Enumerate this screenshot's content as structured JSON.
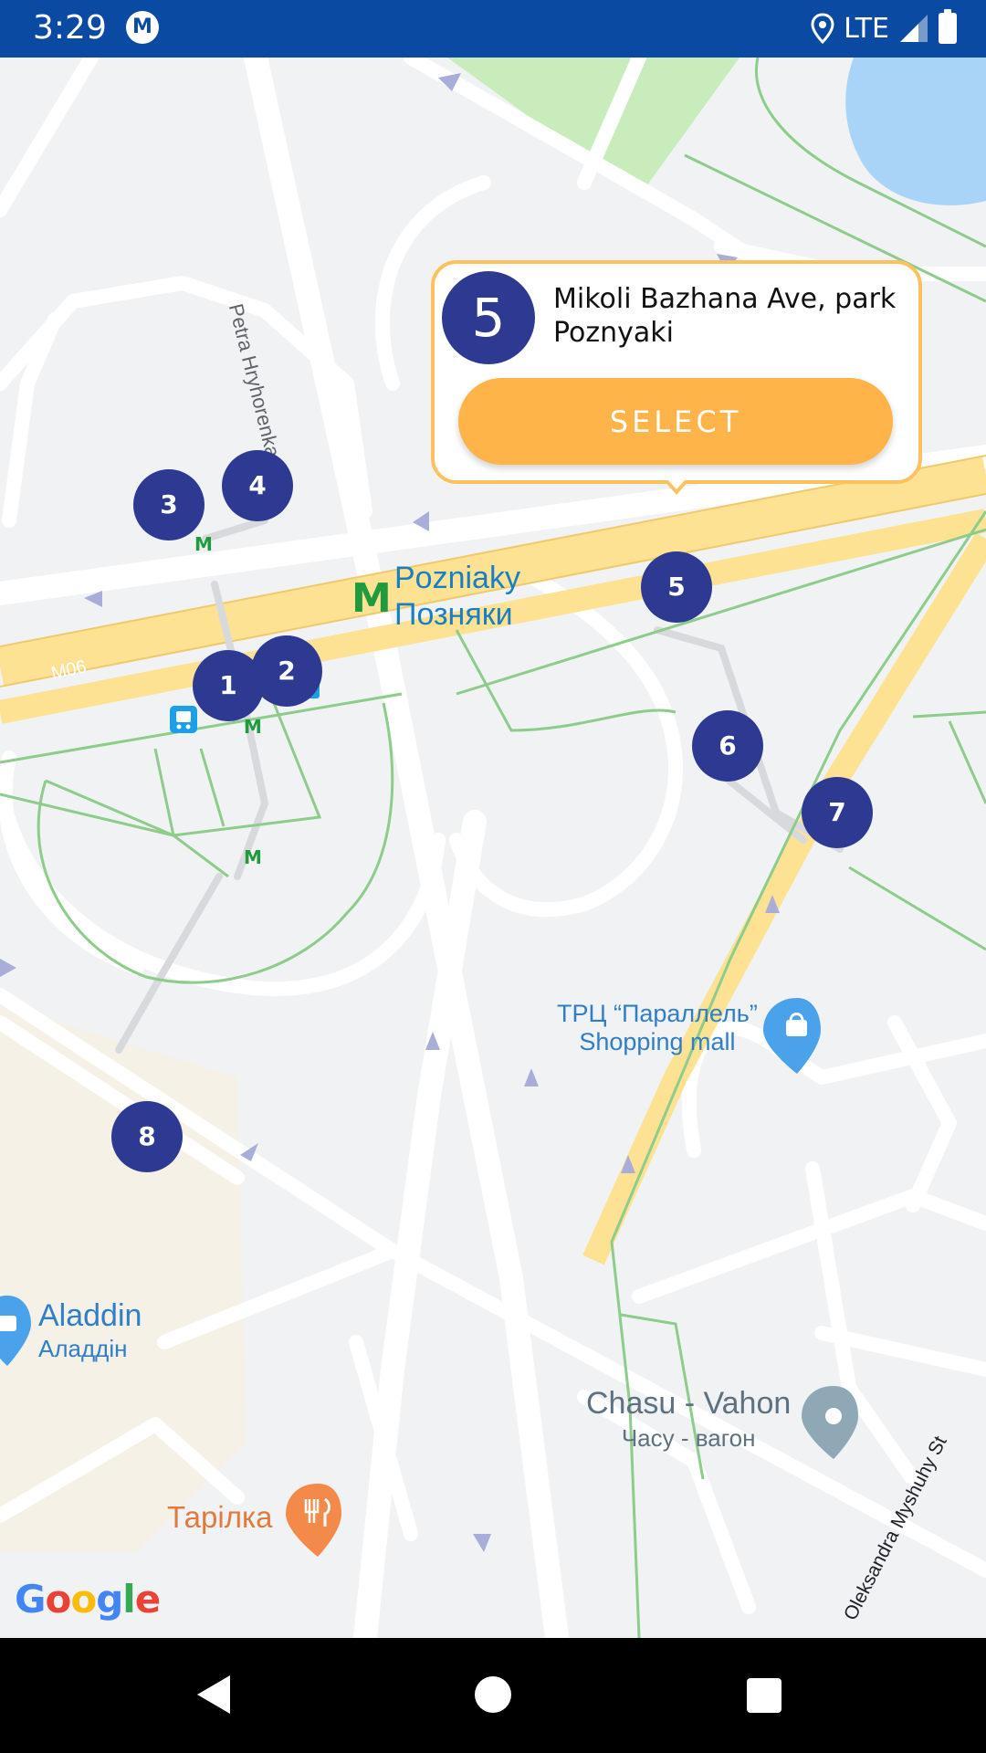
{
  "status_bar": {
    "time": "3:29",
    "brand_glyph": "M",
    "network": "LTE"
  },
  "map": {
    "metro_station": {
      "name_en": "Pozniaky",
      "name_uk": "Позняки"
    },
    "road_labels": {
      "hryhorenka": "Petra Hryhorenka Ave",
      "m06": "M06",
      "myshuhy": "Oleksandra Myshuhy St"
    },
    "pois": {
      "parallel": {
        "line1": "ТРЦ “Параллель”",
        "line2": "Shopping mall"
      },
      "aladdin": {
        "line1": "Aladdin",
        "line2": "Аладдін"
      },
      "chasu": {
        "line1": "Chasu - Vahon",
        "line2": "Часу - вагон"
      },
      "tarilka": "Тарілка"
    },
    "markers": [
      "1",
      "2",
      "3",
      "4",
      "5",
      "6",
      "7",
      "8"
    ],
    "attribution": [
      "G",
      "o",
      "o",
      "g",
      "l",
      "e"
    ],
    "attribution_colors": [
      "#4285F4",
      "#EA4335",
      "#FBBC05",
      "#4285F4",
      "#34A853",
      "#EA4335"
    ],
    "colors": {
      "marker": "#2e3a92",
      "select_button": "#ffb44a",
      "info_border": "#ffc15e",
      "status_bar": "#0b4aa2"
    }
  },
  "info_window": {
    "number": "5",
    "title": "Mikoli Bazhana Ave, park Poznyaki",
    "select_label": "SELECT"
  },
  "nav_bar": {
    "icons": [
      "back-icon",
      "home-icon",
      "recents-icon"
    ]
  }
}
